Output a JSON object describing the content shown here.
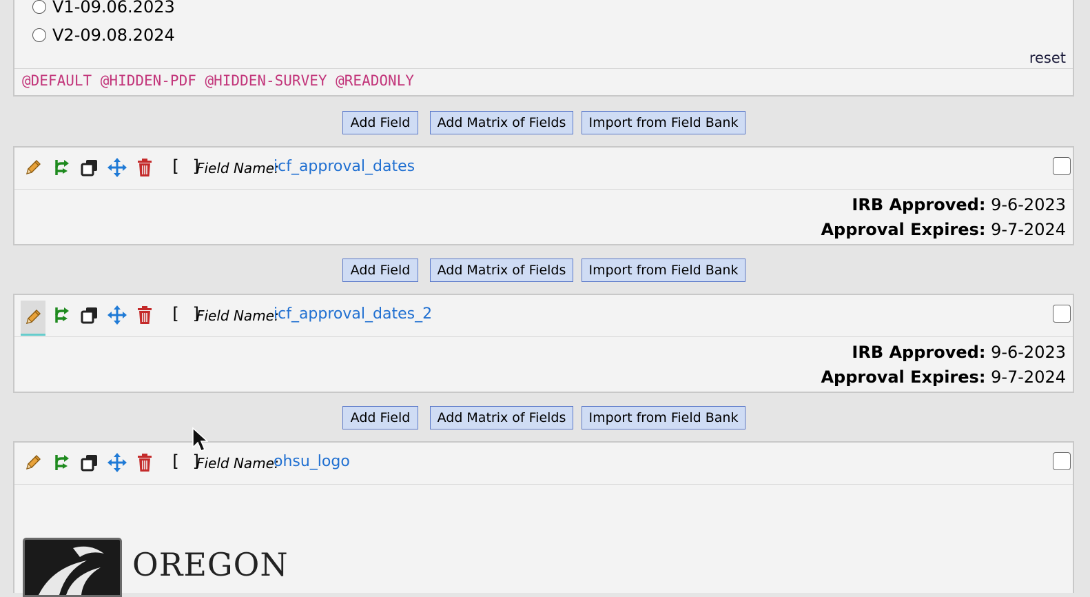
{
  "choices": {
    "options": [
      "V1-09.06.2023",
      "V2-09.08.2024"
    ],
    "reset_label": "reset"
  },
  "annotation_tags": "@DEFAULT @HIDDEN-PDF @HIDDEN-SURVEY @READONLY",
  "buttons": {
    "add_field": "Add Field",
    "add_matrix": "Add Matrix of Fields",
    "import_bank": "Import from Field Bank"
  },
  "field_label": "Field Name:",
  "bracket": "[ ]",
  "fields": [
    {
      "name": "icf_approval_dates",
      "lines": [
        {
          "label": "IRB Approved:",
          "value": "9-6-2023"
        },
        {
          "label": "Approval Expires:",
          "value": "9-7-2024"
        }
      ]
    },
    {
      "name": "icf_approval_dates_2",
      "lines": [
        {
          "label": "IRB Approved:",
          "value": "9-6-2023"
        },
        {
          "label": "Approval Expires:",
          "value": "9-7-2024"
        }
      ]
    },
    {
      "name": "ohsu_logo",
      "logo_text": "OREGON"
    }
  ],
  "icons": [
    "pencil-icon",
    "branching-icon",
    "copy-icon",
    "move-icon",
    "trash-icon"
  ],
  "colors": {
    "annotation": "#c2357a",
    "link": "#1f6fd1",
    "button_bg": "#cfdcf4",
    "button_border": "#5a78c8"
  }
}
